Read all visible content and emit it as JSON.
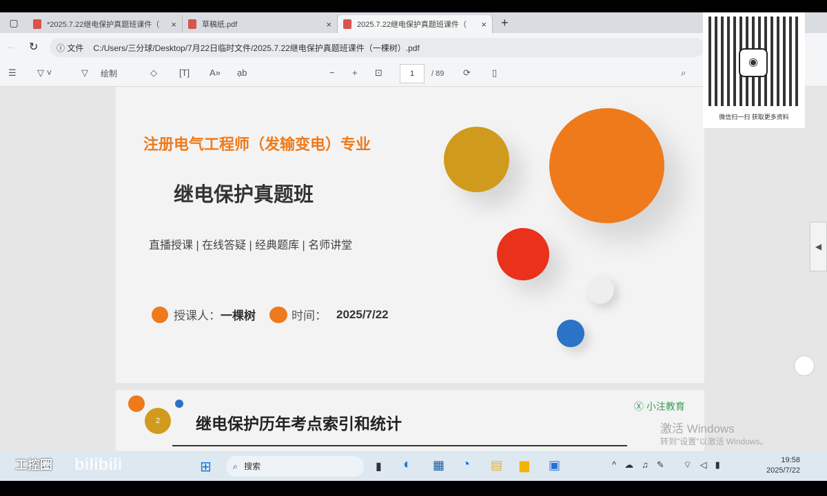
{
  "tabs": [
    {
      "title": "*2025.7.22继电保护真题班课件（",
      "close": "×"
    },
    {
      "title": "草稿纸.pdf",
      "close": "×"
    },
    {
      "title": "2025.7.22继电保护真题班课件（",
      "close": "×"
    }
  ],
  "new_tab": "+",
  "address": {
    "label": "文件",
    "url": "C:/Users/三分球/Desktop/7月22日临时文件/2025.7.22继电保护真题班课件（一棵树）.pdf"
  },
  "toolbar": {
    "draw": "绘制",
    "page_current": "1",
    "page_total": "/ 89",
    "minus": "−",
    "plus": "+"
  },
  "slide": {
    "subtitle": "注册电气工程师（发输变电）专业",
    "title": "继电保护真题班",
    "features": "直播授课 | 在线答疑 | 经典题库 | 名师讲堂",
    "lecturer_label": "授课人：",
    "lecturer": "一棵树",
    "time_label": "时间：",
    "date": "2025/7/22"
  },
  "slide2": {
    "number": "2",
    "title": "继电保护历年考点索引和统计",
    "brand": "小注教育"
  },
  "qr": {
    "caption": "微信扫一扫 获取更多资料"
  },
  "watermark": {
    "line1": "激活 Windows",
    "line2": "转到\"设置\"以激活 Windows。"
  },
  "taskbar": {
    "search": "搜索",
    "time": "19:58",
    "date": "2025/7/22",
    "overlay": "工控圈",
    "bili": "bilibili"
  },
  "colors": {
    "orange": "#ee7a1b",
    "gold": "#d09a1c",
    "red": "#e9311c",
    "blue": "#2a73c6"
  }
}
